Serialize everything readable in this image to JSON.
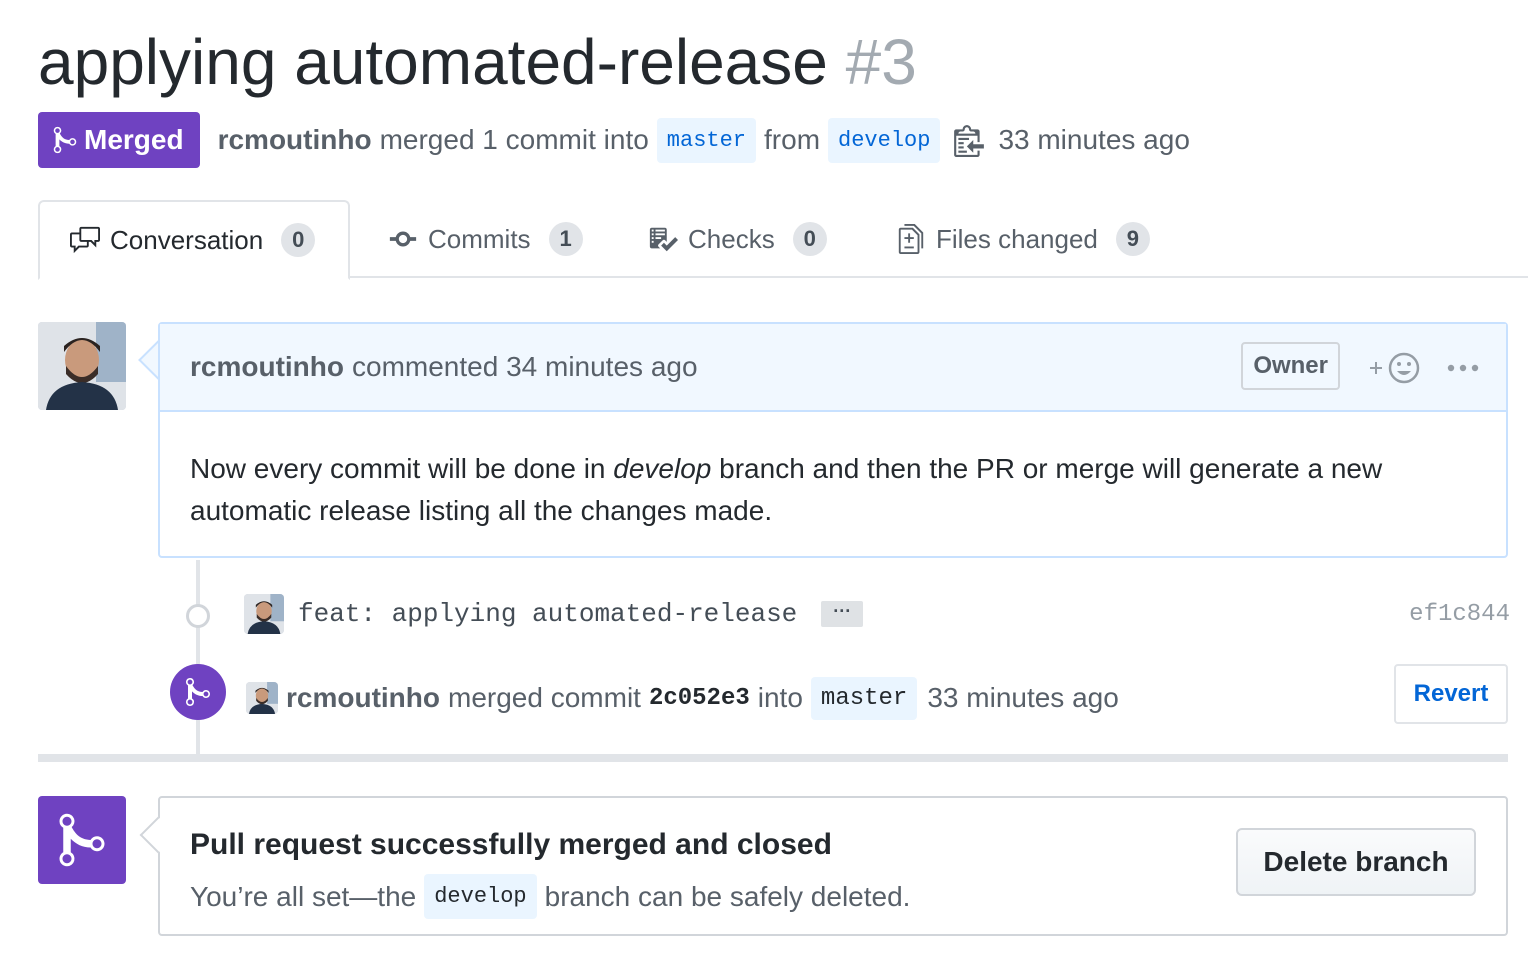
{
  "pr": {
    "title": "applying automated-release",
    "number": "#3",
    "state_label": "Merged",
    "author": "rcmoutinho",
    "merged_text": "merged 1 commit into",
    "base_branch": "master",
    "from_text": "from",
    "head_branch": "develop",
    "time_ago": "33 minutes ago"
  },
  "tabs": [
    {
      "label": "Conversation",
      "count": "0",
      "icon": "comment-discussion-icon"
    },
    {
      "label": "Commits",
      "count": "1",
      "icon": "git-commit-icon"
    },
    {
      "label": "Checks",
      "count": "0",
      "icon": "checklist-icon"
    },
    {
      "label": "Files changed",
      "count": "9",
      "icon": "file-diff-icon"
    }
  ],
  "comment": {
    "author": "rcmoutinho",
    "action": "commented 34 minutes ago",
    "badge": "Owner",
    "body_before": "Now every commit will be done in ",
    "body_em": "develop",
    "body_after": " branch and then the PR or merge will generate a new automatic release listing all the changes made."
  },
  "commit": {
    "message": "feat: applying automated-release",
    "ellipsis": "···",
    "sha": "ef1c844"
  },
  "merge_event": {
    "author": "rcmoutinho",
    "text1": "merged commit",
    "sha": "2c052e3",
    "text2": "into",
    "branch": "master",
    "time_ago": "33 minutes ago",
    "revert_label": "Revert"
  },
  "merge_status": {
    "title": "Pull request successfully merged and closed",
    "sub_before": "You’re all set—the",
    "branch": "develop",
    "sub_after": "branch can be safely deleted.",
    "delete_label": "Delete branch"
  },
  "colors": {
    "merged_purple": "#6f42c1",
    "link_blue": "#0366d6",
    "branch_bg": "#eaf5ff"
  }
}
